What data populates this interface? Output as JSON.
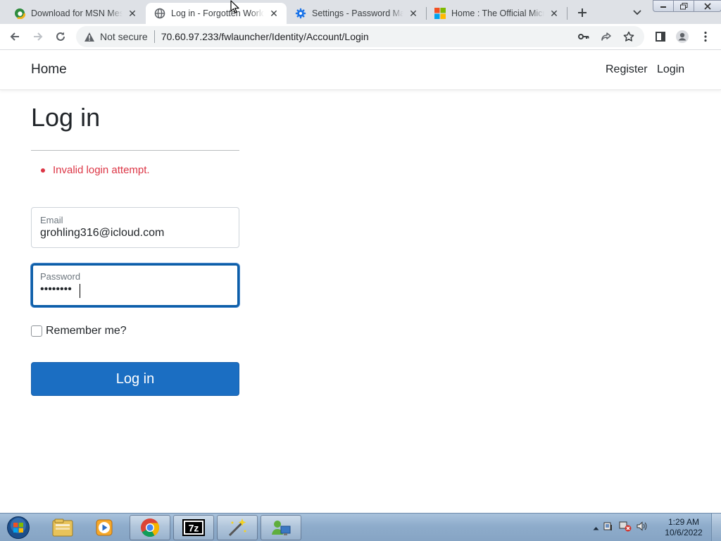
{
  "browser": {
    "tabs": [
      {
        "title": "Download for MSN Messenger",
        "icon": "edge-icon"
      },
      {
        "title": "Log in - Forgotten World",
        "icon": "globe-icon"
      },
      {
        "title": "Settings - Password Manager",
        "icon": "gear-icon"
      },
      {
        "title": "Home : The Official Microsoft",
        "icon": "microsoft-icon"
      }
    ],
    "security_label": "Not secure",
    "url": "70.60.97.233/fwlauncher/Identity/Account/Login"
  },
  "site": {
    "brand": "Home",
    "nav": {
      "register": "Register",
      "login": "Login"
    }
  },
  "page": {
    "title": "Log in",
    "errors": [
      "Invalid login attempt."
    ],
    "email": {
      "label": "Email",
      "value": "grohling316@icloud.com"
    },
    "password": {
      "label": "Password",
      "value": "••••••••"
    },
    "remember_label": "Remember me?",
    "submit_label": "Log in"
  },
  "taskbar": {
    "time": "1:29 AM",
    "date": "10/6/2022",
    "apps": [
      "explorer-icon",
      "media-player-icon",
      "chrome-icon",
      "7zip-icon",
      "wizard-icon",
      "network-app-icon"
    ]
  },
  "colors": {
    "primary_button": "#1b6ec2",
    "error": "#dc3545",
    "focus_border": "#0d5ea8"
  }
}
